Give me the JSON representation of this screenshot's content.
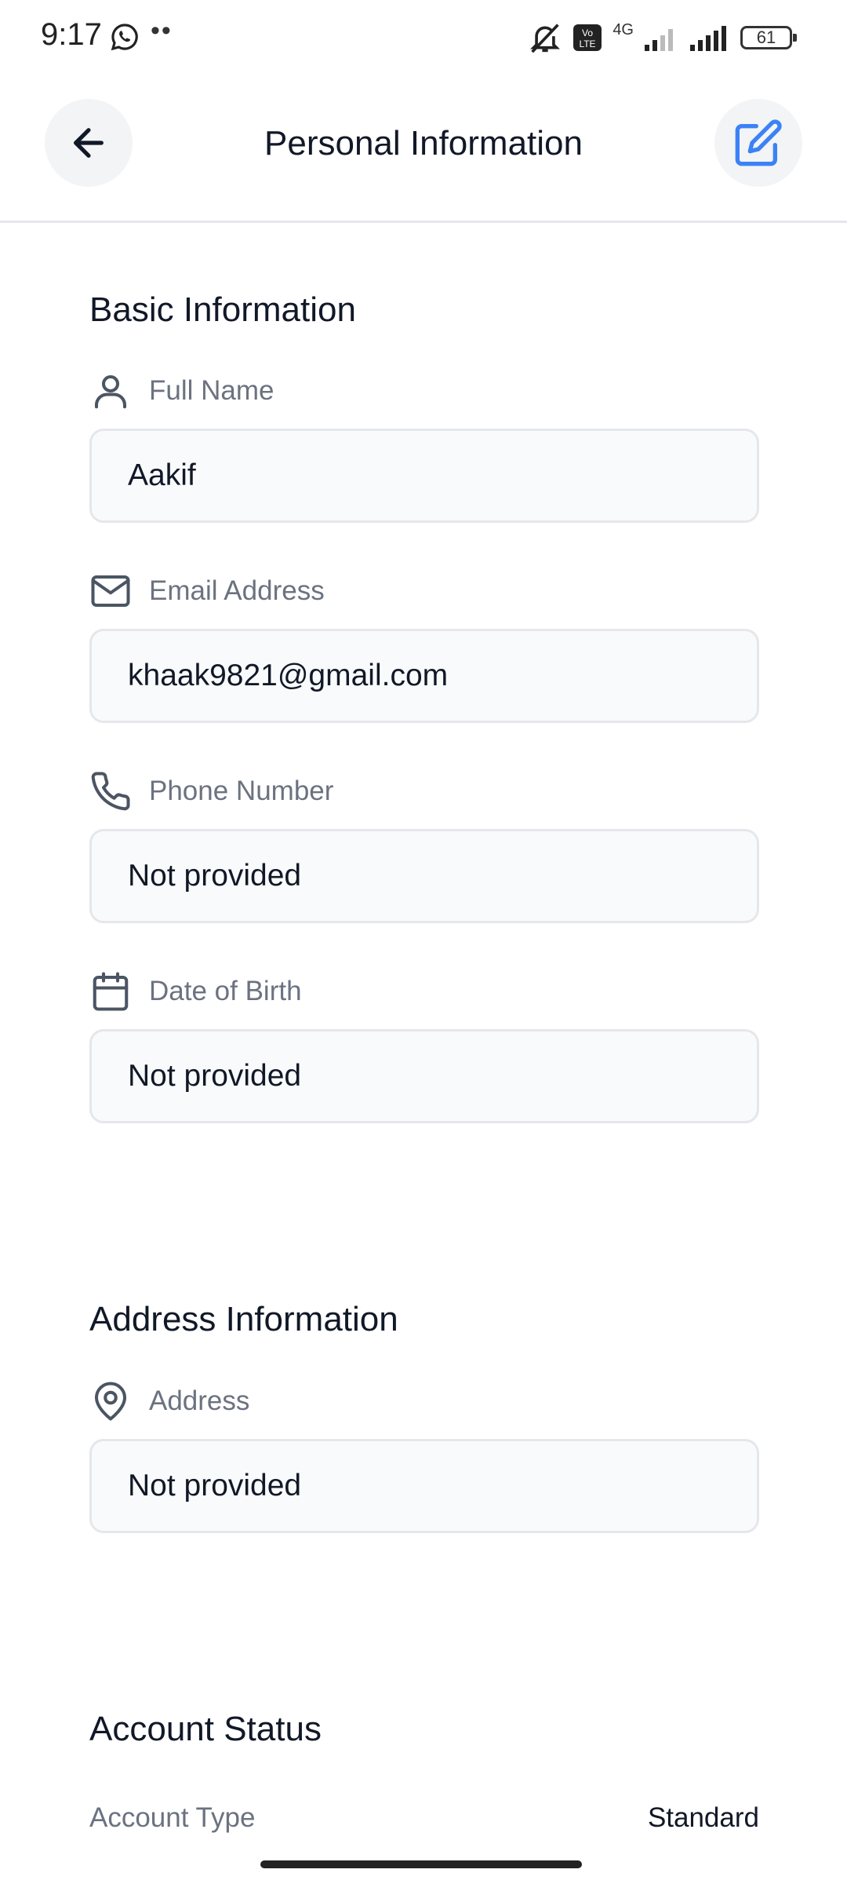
{
  "status_bar": {
    "time": "9:17",
    "network_label": "4G",
    "battery": "61",
    "icons": [
      "whatsapp-icon",
      "more-dots-icon",
      "mute-icon",
      "volte-icon",
      "signal-icon",
      "signal-icon",
      "battery-icon"
    ]
  },
  "header": {
    "title": "Personal Information",
    "back_icon": "arrow-left-icon",
    "edit_icon": "edit-icon"
  },
  "basic_info": {
    "title": "Basic Information",
    "fields": [
      {
        "icon": "user-icon",
        "label": "Full Name",
        "value": "Aakif"
      },
      {
        "icon": "mail-icon",
        "label": "Email Address",
        "value": "khaak9821@gmail.com"
      },
      {
        "icon": "phone-icon",
        "label": "Phone Number",
        "value": "Not provided"
      },
      {
        "icon": "calendar-icon",
        "label": "Date of Birth",
        "value": "Not provided"
      }
    ]
  },
  "address_info": {
    "title": "Address Information",
    "fields": [
      {
        "icon": "map-pin-icon",
        "label": "Address",
        "value": "Not provided"
      }
    ]
  },
  "account_status": {
    "title": "Account Status",
    "rows": [
      {
        "label": "Account Type",
        "value": "Standard"
      }
    ]
  },
  "colors": {
    "accent": "#3b82f6",
    "label_gray": "#6b7280",
    "field_bg": "#f9fafb",
    "field_border": "#e5e7eb",
    "text": "#111827"
  }
}
